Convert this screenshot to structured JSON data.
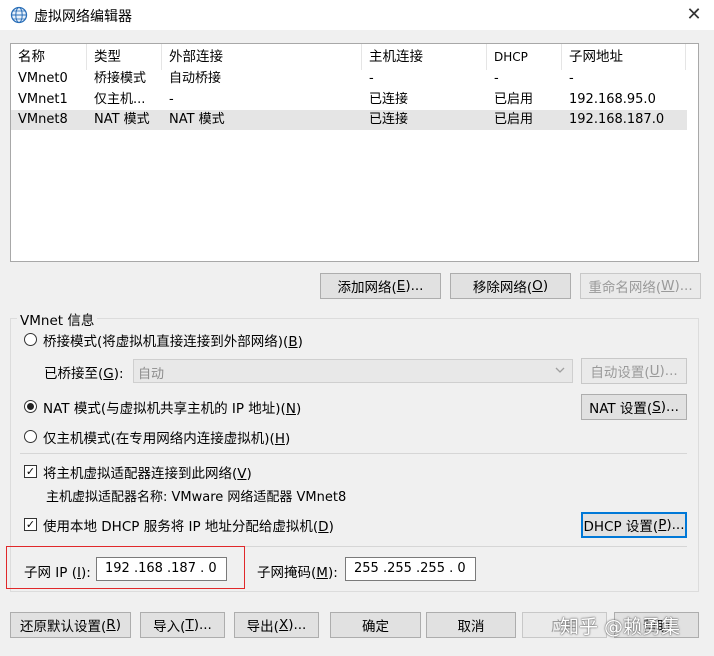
{
  "window": {
    "title": "虚拟网络编辑器",
    "close_glyph": "✕"
  },
  "table": {
    "headers": [
      "名称",
      "类型",
      "外部连接",
      "主机连接",
      "DHCP",
      "子网地址"
    ],
    "rows": [
      [
        "VMnet0",
        "桥接模式",
        "自动桥接",
        "-",
        "-",
        "-"
      ],
      [
        "VMnet1",
        "仅主机...",
        "-",
        "已连接",
        "已启用",
        "192.168.95.0"
      ],
      [
        "VMnet8",
        "NAT 模式",
        "NAT 模式",
        "已连接",
        "已启用",
        "192.168.187.0"
      ]
    ],
    "selected_row": 2
  },
  "table_buttons": {
    "add": {
      "text": "添加网络(",
      "key": "E",
      "tail": ")..."
    },
    "remove": {
      "text": "移除网络(",
      "key": "O",
      "tail": ")"
    },
    "rename": {
      "text": "重命名网络(",
      "key": "W",
      "tail": ")..."
    }
  },
  "vmnet_info": {
    "title": "VMnet 信息",
    "bridge_mode": {
      "text": "桥接模式(将虚拟机直接连接到外部网络)(",
      "key": "B",
      "tail": ")"
    },
    "bridged_to": {
      "text": "已桥接至(",
      "key": "G",
      "tail": "):"
    },
    "bridged_value": "自动",
    "auto_settings": {
      "text": "自动设置(",
      "key": "U",
      "tail": ")..."
    },
    "nat_mode": {
      "text": "NAT 模式(与虚拟机共享主机的 IP 地址)(",
      "key": "N",
      "tail": ")"
    },
    "nat_settings": {
      "text": "NAT 设置(",
      "key": "S",
      "tail": ")..."
    },
    "host_only": {
      "text": "仅主机模式(在专用网络内连接虚拟机)(",
      "key": "H",
      "tail": ")"
    },
    "connect_adapter": {
      "text": "将主机虚拟适配器连接到此网络(",
      "key": "V",
      "tail": ")"
    },
    "adapter_name": "主机虚拟适配器名称: VMware 网络适配器 VMnet8",
    "use_dhcp": {
      "text": "使用本地 DHCP 服务将 IP 地址分配给虚拟机(",
      "key": "D",
      "tail": ")"
    },
    "dhcp_settings": {
      "text": "DHCP 设置(",
      "key": "P",
      "tail": ")..."
    },
    "subnet_ip": {
      "text": "子网 IP (",
      "key": "I",
      "tail": "):",
      "value": "192 .168 .187 . 0"
    },
    "subnet_mask": {
      "text": "子网掩码(",
      "key": "M",
      "tail": "):",
      "value": "255 .255 .255 . 0"
    }
  },
  "bottom_buttons": {
    "restore": {
      "text": "还原默认设置(",
      "key": "R",
      "tail": ")"
    },
    "import": {
      "text": "导入(",
      "key": "T",
      "tail": ")..."
    },
    "export": {
      "text": "导出(",
      "key": "X",
      "tail": ")..."
    },
    "ok": "确定",
    "cancel": "取消",
    "apply": "应用",
    "help": "帮助"
  },
  "watermark": "知乎 @赖勇集",
  "colors": {
    "accent": "#0078d7",
    "highlight_box": "#e0282a",
    "selected_row": "#e5e5e5"
  }
}
